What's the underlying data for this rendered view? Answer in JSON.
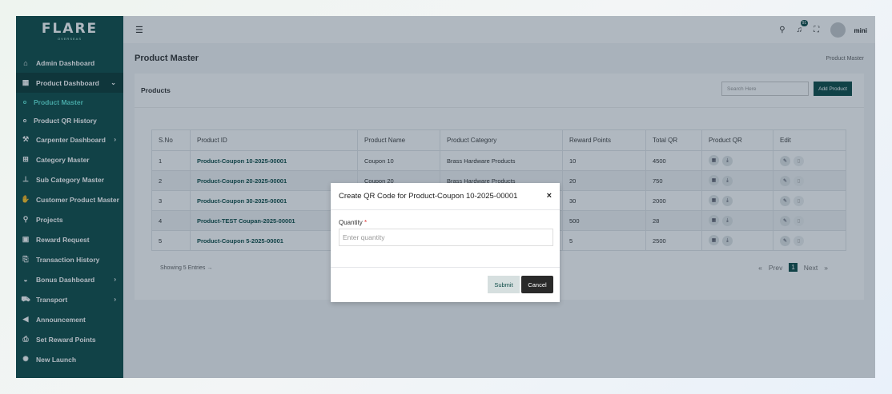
{
  "brand": {
    "name": "FLARE",
    "tagline": "OVERSEAS"
  },
  "sidebar": {
    "items": [
      {
        "label": "Admin Dashboard",
        "icon": "home-icon"
      },
      {
        "label": "Product Dashboard",
        "icon": "grid-icon",
        "chevron": "⌄"
      },
      {
        "label": "Product Master",
        "sub": true,
        "current": true
      },
      {
        "label": "Product QR History",
        "sub": true
      },
      {
        "label": "Carpenter Dashboard",
        "icon": "carpenter-icon",
        "chevron": "›"
      },
      {
        "label": "Category Master",
        "icon": "category-icon"
      },
      {
        "label": "Sub Category Master",
        "icon": "sitemap-icon"
      },
      {
        "label": "Customer Product Master",
        "icon": "customer-icon"
      },
      {
        "label": "Projects",
        "icon": "projects-icon"
      },
      {
        "label": "Reward Request",
        "icon": "reward-icon"
      },
      {
        "label": "Transaction History",
        "icon": "transaction-icon"
      },
      {
        "label": "Bonus Dashboard",
        "icon": "bonus-icon",
        "chevron": "›"
      },
      {
        "label": "Transport",
        "icon": "truck-icon",
        "chevron": "›"
      },
      {
        "label": "Announcement",
        "icon": "megaphone-icon"
      },
      {
        "label": "Set Reward Points",
        "icon": "points-icon"
      },
      {
        "label": "New Launch",
        "icon": "rocket-icon"
      }
    ]
  },
  "topbar": {
    "notification_count": "91",
    "username": "mini"
  },
  "page": {
    "title": "Product Master",
    "breadcrumb": "Product Master"
  },
  "card": {
    "title": "Products",
    "search_placeholder": "Search Here",
    "add_button": "Add Product"
  },
  "table": {
    "headers": [
      "S.No",
      "Product ID",
      "Product Name",
      "Product Category",
      "Reward Points",
      "Total QR",
      "Product QR",
      "Edit"
    ],
    "rows": [
      {
        "sno": "1",
        "id": "Product-Coupon 10-2025-00001",
        "name": "Coupon 10",
        "category": "Brass Hardware Products",
        "points": "10",
        "total": "4500"
      },
      {
        "sno": "2",
        "id": "Product-Coupon 20-2025-00001",
        "name": "Coupon 20",
        "category": "Brass Hardware Products",
        "points": "20",
        "total": "750"
      },
      {
        "sno": "3",
        "id": "Product-Coupon 30-2025-00001",
        "name": "",
        "category": "",
        "points": "30",
        "total": "2000"
      },
      {
        "sno": "4",
        "id": "Product-TEST Coupan-2025-00001",
        "name": "",
        "category": "",
        "points": "500",
        "total": "28"
      },
      {
        "sno": "5",
        "id": "Product-Coupon 5-2025-00001",
        "name": "",
        "category": "",
        "points": "5",
        "total": "2500"
      }
    ]
  },
  "footer": {
    "showing": "Showing 5 Entries",
    "arrow": "→",
    "first": "«",
    "prev": "Prev",
    "page": "1",
    "next": "Next",
    "last": "»"
  },
  "modal": {
    "title": "Create QR Code for Product-Coupon 10-2025-00001",
    "close": "×",
    "quantity_label": "Quantity",
    "required_mark": "*",
    "quantity_placeholder": "Enter quantity",
    "submit": "Submit",
    "cancel": "Cancel"
  },
  "colors": {
    "brand": "#0f4d48",
    "active_sub": "#5de3d4"
  }
}
